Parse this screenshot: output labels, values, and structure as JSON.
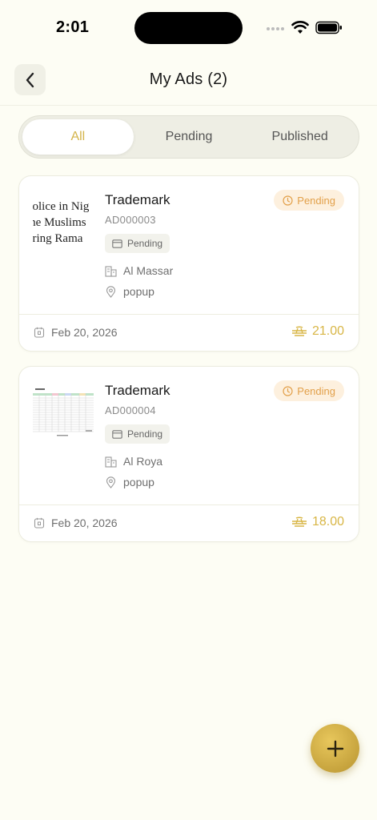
{
  "status_bar": {
    "time": "2:01"
  },
  "header": {
    "title": "My Ads (2)"
  },
  "tabs": [
    {
      "label": "All",
      "active": true
    },
    {
      "label": "Pending",
      "active": false
    },
    {
      "label": "Published",
      "active": false
    }
  ],
  "ads": [
    {
      "title": "Trademark",
      "code": "AD000003",
      "type_badge": "Pending",
      "status": "Pending",
      "company": "Al Massar",
      "location": "popup",
      "date": "Feb 20, 2026",
      "price": "21.00",
      "thumbnail_lines": [
        "police in Nig",
        "the Muslims",
        "uring Rama"
      ]
    },
    {
      "title": "Trademark",
      "code": "AD000004",
      "type_badge": "Pending",
      "status": "Pending",
      "company": "Al Roya",
      "location": "popup",
      "date": "Feb 20, 2026",
      "price": "18.00"
    }
  ],
  "colors": {
    "background": "#fdfdf4",
    "accent_gold": "#d4b44a",
    "pending_text": "#e2a04a",
    "pending_bg": "#fdf0de"
  },
  "icons": {
    "back": "chevron-left-icon",
    "status": "clock-icon",
    "type": "card-icon",
    "company": "building-icon",
    "location": "location-pin-icon",
    "date": "calendar-icon",
    "currency": "currency-icon",
    "fab": "plus-icon"
  }
}
